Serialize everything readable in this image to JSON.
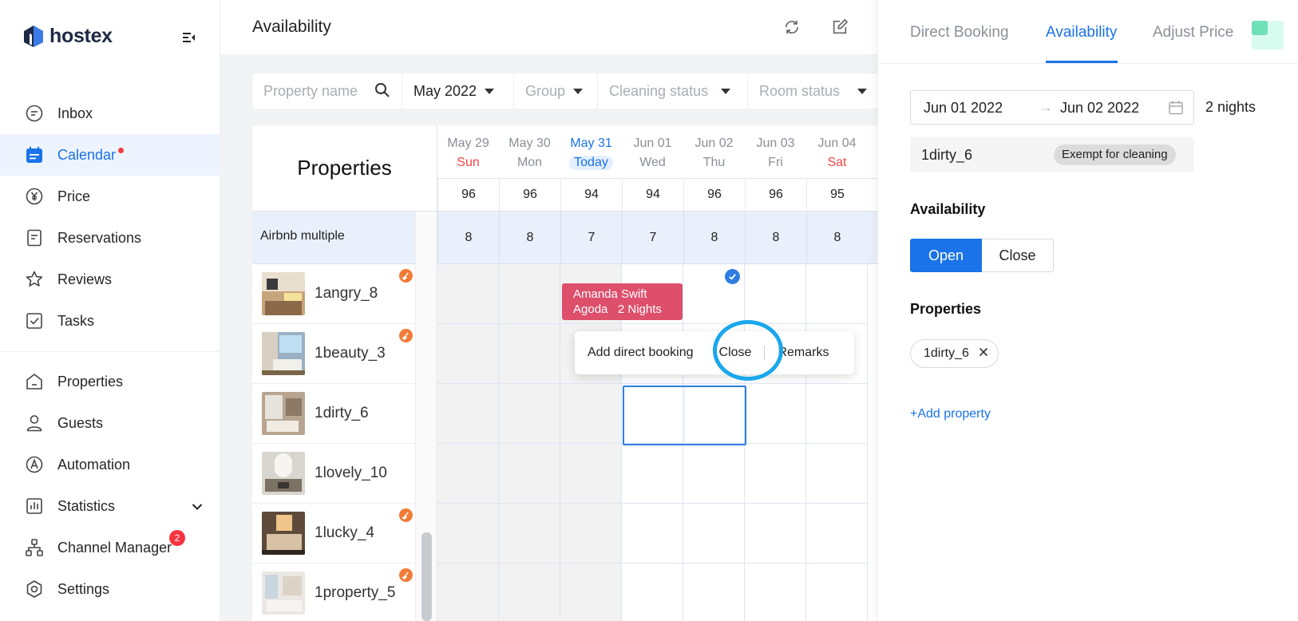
{
  "app": {
    "name": "hostex"
  },
  "sidebar": {
    "items": [
      {
        "label": "Inbox",
        "icon": "chat-icon"
      },
      {
        "label": "Calendar",
        "icon": "calendar-icon",
        "active": true,
        "dot": true
      },
      {
        "label": "Price",
        "icon": "yen-icon"
      },
      {
        "label": "Reservations",
        "icon": "document-icon"
      },
      {
        "label": "Reviews",
        "icon": "star-icon"
      },
      {
        "label": "Tasks",
        "icon": "checkbox-icon"
      },
      {
        "label": "Properties",
        "icon": "house-icon"
      },
      {
        "label": "Guests",
        "icon": "person-icon"
      },
      {
        "label": "Automation",
        "icon": "automation-icon"
      },
      {
        "label": "Statistics",
        "icon": "bar-chart-icon"
      },
      {
        "label": "Channel Manager",
        "icon": "network-icon",
        "badge": "2"
      },
      {
        "label": "Settings",
        "icon": "gear-icon"
      }
    ]
  },
  "header": {
    "title": "Availability"
  },
  "filters": {
    "property_placeholder": "Property name",
    "month": "May 2022",
    "group": "Group",
    "cleaning": "Cleaning status",
    "room": "Room status"
  },
  "calendar": {
    "properties_heading": "Properties",
    "days": [
      {
        "date": "May 29",
        "name": "Sun",
        "count": "96"
      },
      {
        "date": "May 30",
        "name": "Mon",
        "count": "96"
      },
      {
        "date": "May 31",
        "name": "Today",
        "count": "94"
      },
      {
        "date": "Jun 01",
        "name": "Wed",
        "count": "94"
      },
      {
        "date": "Jun 02",
        "name": "Thu",
        "count": "96"
      },
      {
        "date": "Jun 03",
        "name": "Fri",
        "count": "96"
      },
      {
        "date": "Jun 04",
        "name": "Sat",
        "count": "95"
      }
    ],
    "group": {
      "name": "Airbnb multiple",
      "counts": [
        "8",
        "8",
        "7",
        "7",
        "8",
        "8",
        "8"
      ]
    },
    "properties": [
      {
        "name": "1angry_8",
        "cleaning": true
      },
      {
        "name": "1beauty_3",
        "cleaning": true
      },
      {
        "name": "1dirty_6",
        "cleaning": false
      },
      {
        "name": "1lovely_10",
        "cleaning": false
      },
      {
        "name": "1lucky_4",
        "cleaning": true
      },
      {
        "name": "1property_5",
        "cleaning": true
      }
    ],
    "booking": {
      "guest": "Amanda Swift",
      "channel": "Agoda",
      "nights": "2 Nights"
    }
  },
  "context_menu": {
    "add_booking": "Add direct booking",
    "close": "Close",
    "remarks": "Remarks"
  },
  "panel": {
    "tabs": [
      "Direct Booking",
      "Availability",
      "Adjust Price"
    ],
    "active_tab": "Availability",
    "date_start": "Jun 01 2022",
    "date_end": "Jun 02 2022",
    "date_arrow": "→",
    "nights": "2 nights",
    "property": "1dirty_6",
    "exempt_label": "Exempt for cleaning",
    "availability_label": "Availability",
    "open_label": "Open",
    "close_label": "Close",
    "properties_label": "Properties",
    "tag": "1dirty_6",
    "add_property": "+Add property"
  },
  "colors": {
    "accent": "#1a73e8",
    "booking": "#dd4f6b",
    "weekend": "#f04545",
    "cleaning_badge": "#f27b35",
    "highlight_ring": "#1aa7ec"
  }
}
